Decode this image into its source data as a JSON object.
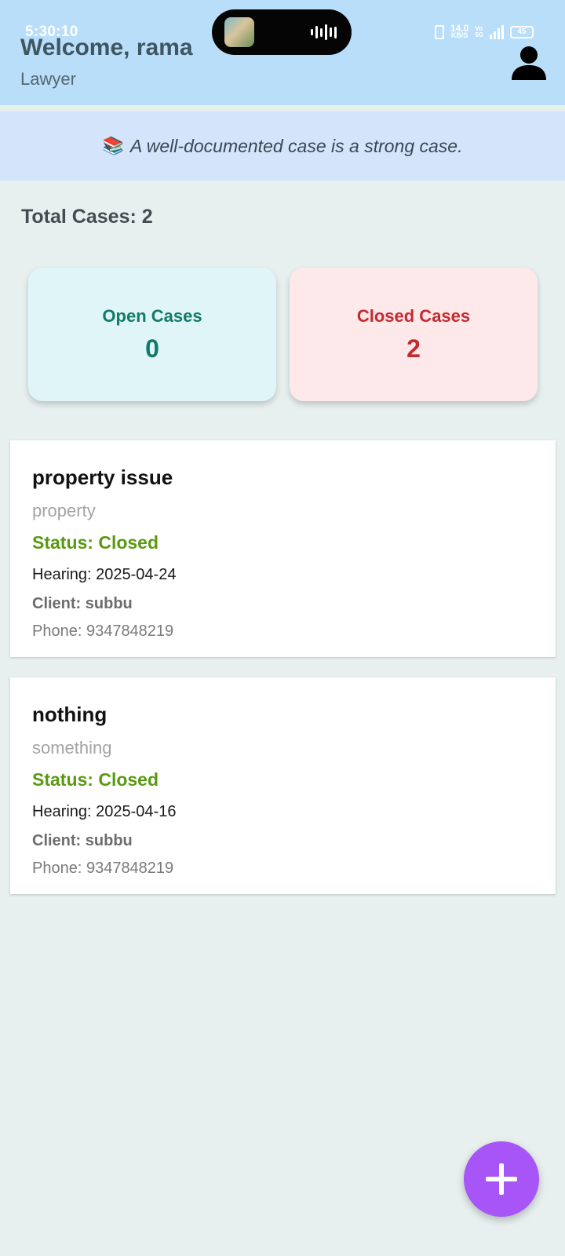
{
  "status_bar": {
    "time": "5:30:10",
    "net_speed": "14.0",
    "net_unit": "KB/S",
    "vo_top": "Vo",
    "vo_bottom": "5G",
    "network": "5G",
    "battery": "45"
  },
  "header": {
    "welcome": "Welcome, rama",
    "role": "Lawyer",
    "profile_icon": "person-icon"
  },
  "quote": {
    "icon": "📚",
    "text": "A well-documented case is a strong case."
  },
  "summary": {
    "total_label": "Total Cases: 2",
    "open_label": "Open Cases",
    "open_value": "0",
    "closed_label": "Closed Cases",
    "closed_value": "2"
  },
  "cases": [
    {
      "title": "property issue",
      "category": "property",
      "status": "Status: Closed",
      "hearing": "Hearing: 2025-04-24",
      "client": "Client: subbu",
      "phone": "Phone: 9347848219"
    },
    {
      "title": "nothing",
      "category": "something",
      "status": "Status: Closed",
      "hearing": "Hearing: 2025-04-16",
      "client": "Client: subbu",
      "phone": "Phone: 9347848219"
    }
  ],
  "fab": {
    "icon": "plus-icon"
  },
  "colors": {
    "header_bg": "#b9def9",
    "quote_bg": "#d4e5fb",
    "page_bg": "#e7efef",
    "open_accent": "#127a6b",
    "closed_accent": "#c42b2f",
    "status_green": "#5a9a12",
    "fab": "#a855f7"
  }
}
